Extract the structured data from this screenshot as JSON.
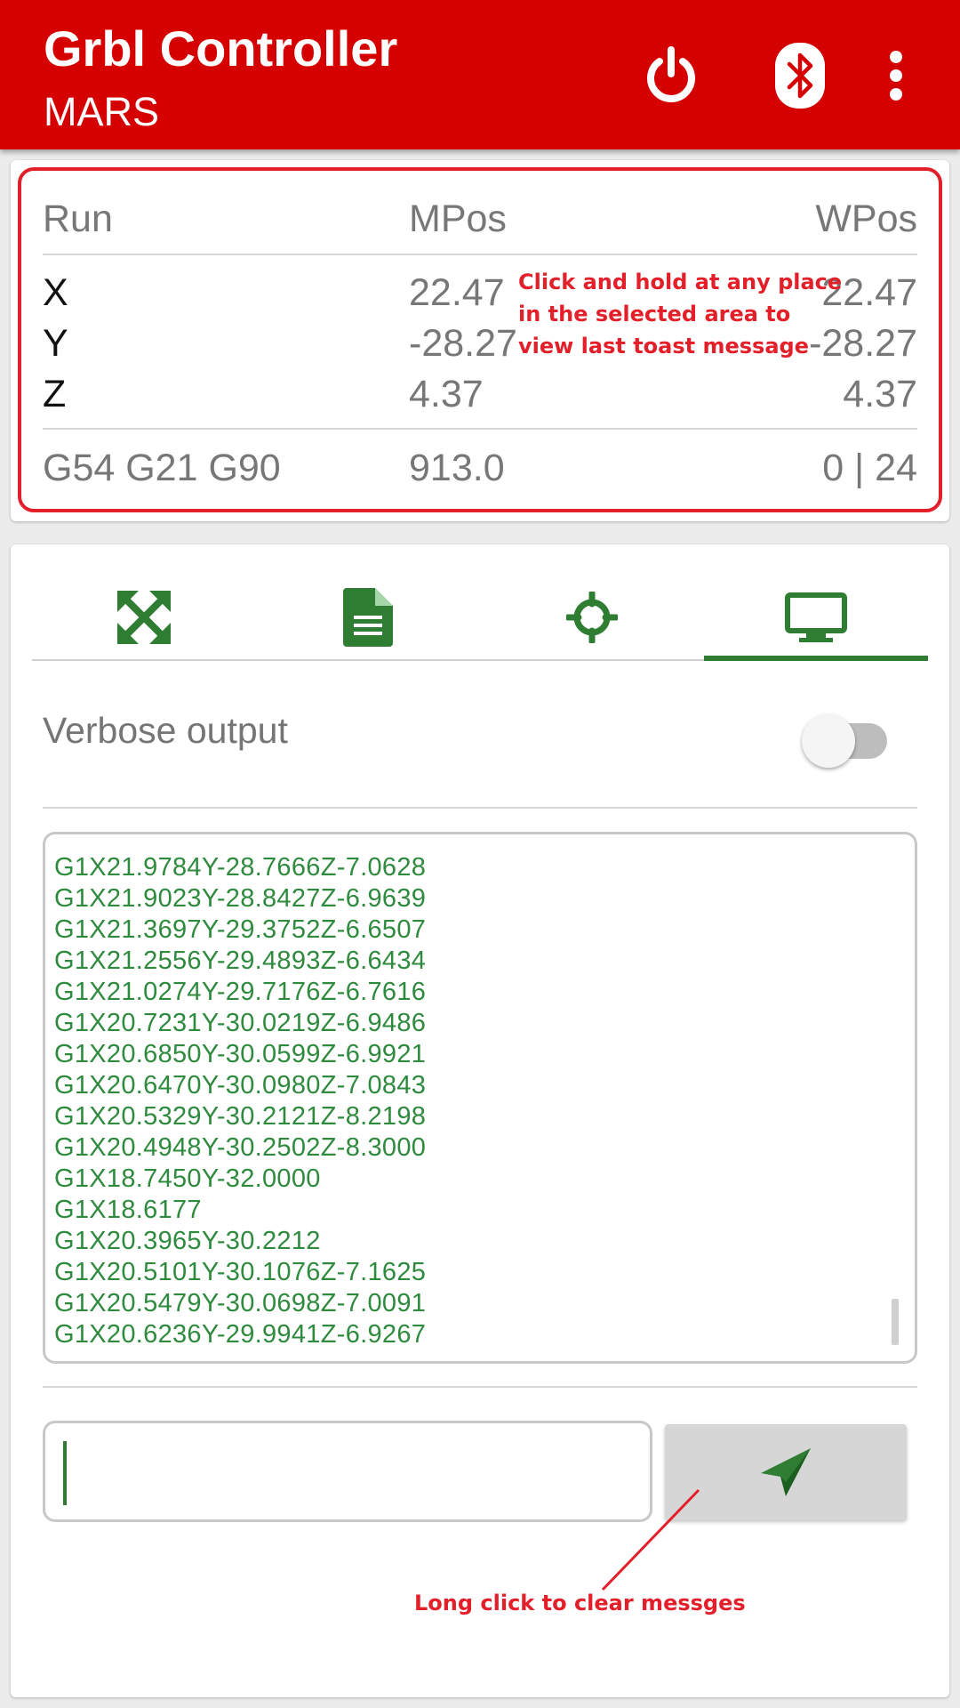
{
  "app": {
    "title": "Grbl Controller",
    "subtitle": "MARS"
  },
  "actions": [
    "power-icon",
    "bluetooth-icon",
    "more-vert-icon"
  ],
  "status": {
    "headers": {
      "state": "Run",
      "mpos": "MPos",
      "wpos": "WPos"
    },
    "axes": [
      {
        "axis": "X",
        "mpos": "22.47",
        "wpos": "22.47"
      },
      {
        "axis": "Y",
        "mpos": "-28.27",
        "wpos": "-28.27"
      },
      {
        "axis": "Z",
        "mpos": "4.37",
        "wpos": "4.37"
      }
    ],
    "footer": {
      "modes": "G54 G21 G90",
      "feed": "913.0",
      "buffer": "0 | 24"
    }
  },
  "annotations": {
    "toast_hint": [
      "Click and hold at any place",
      "in the selected area to",
      "view last toast message"
    ],
    "clear_hint": "Long click to clear messges"
  },
  "tabs": [
    {
      "icon": "jog-arrows-icon"
    },
    {
      "icon": "file-icon"
    },
    {
      "icon": "probe-crosshair-icon"
    },
    {
      "icon": "console-monitor-icon",
      "selected": true
    }
  ],
  "console": {
    "verbose_label": "Verbose output",
    "verbose_on": false,
    "lines": [
      "G1X21.9784Y-28.7666Z-7.0628",
      "G1X21.9023Y-28.8427Z-6.9639",
      "G1X21.3697Y-29.3752Z-6.6507",
      "G1X21.2556Y-29.4893Z-6.6434",
      "G1X21.0274Y-29.7176Z-6.7616",
      "G1X20.7231Y-30.0219Z-6.9486",
      "G1X20.6850Y-30.0599Z-6.9921",
      "G1X20.6470Y-30.0980Z-7.0843",
      "G1X20.5329Y-30.2121Z-8.2198",
      "G1X20.4948Y-30.2502Z-8.3000",
      "G1X18.7450Y-32.0000",
      "G1X18.6177",
      "G1X20.3965Y-30.2212",
      "G1X20.5101Y-30.1076Z-7.1625",
      "G1X20.5479Y-30.0698Z-7.0091",
      "G1X20.6236Y-29.9941Z-6.9267"
    ],
    "input_value": "",
    "send_icon": "send-icon"
  },
  "colors": {
    "primary": "#d50000",
    "accent": "#2e7d32",
    "annotation": "#e3202a"
  }
}
